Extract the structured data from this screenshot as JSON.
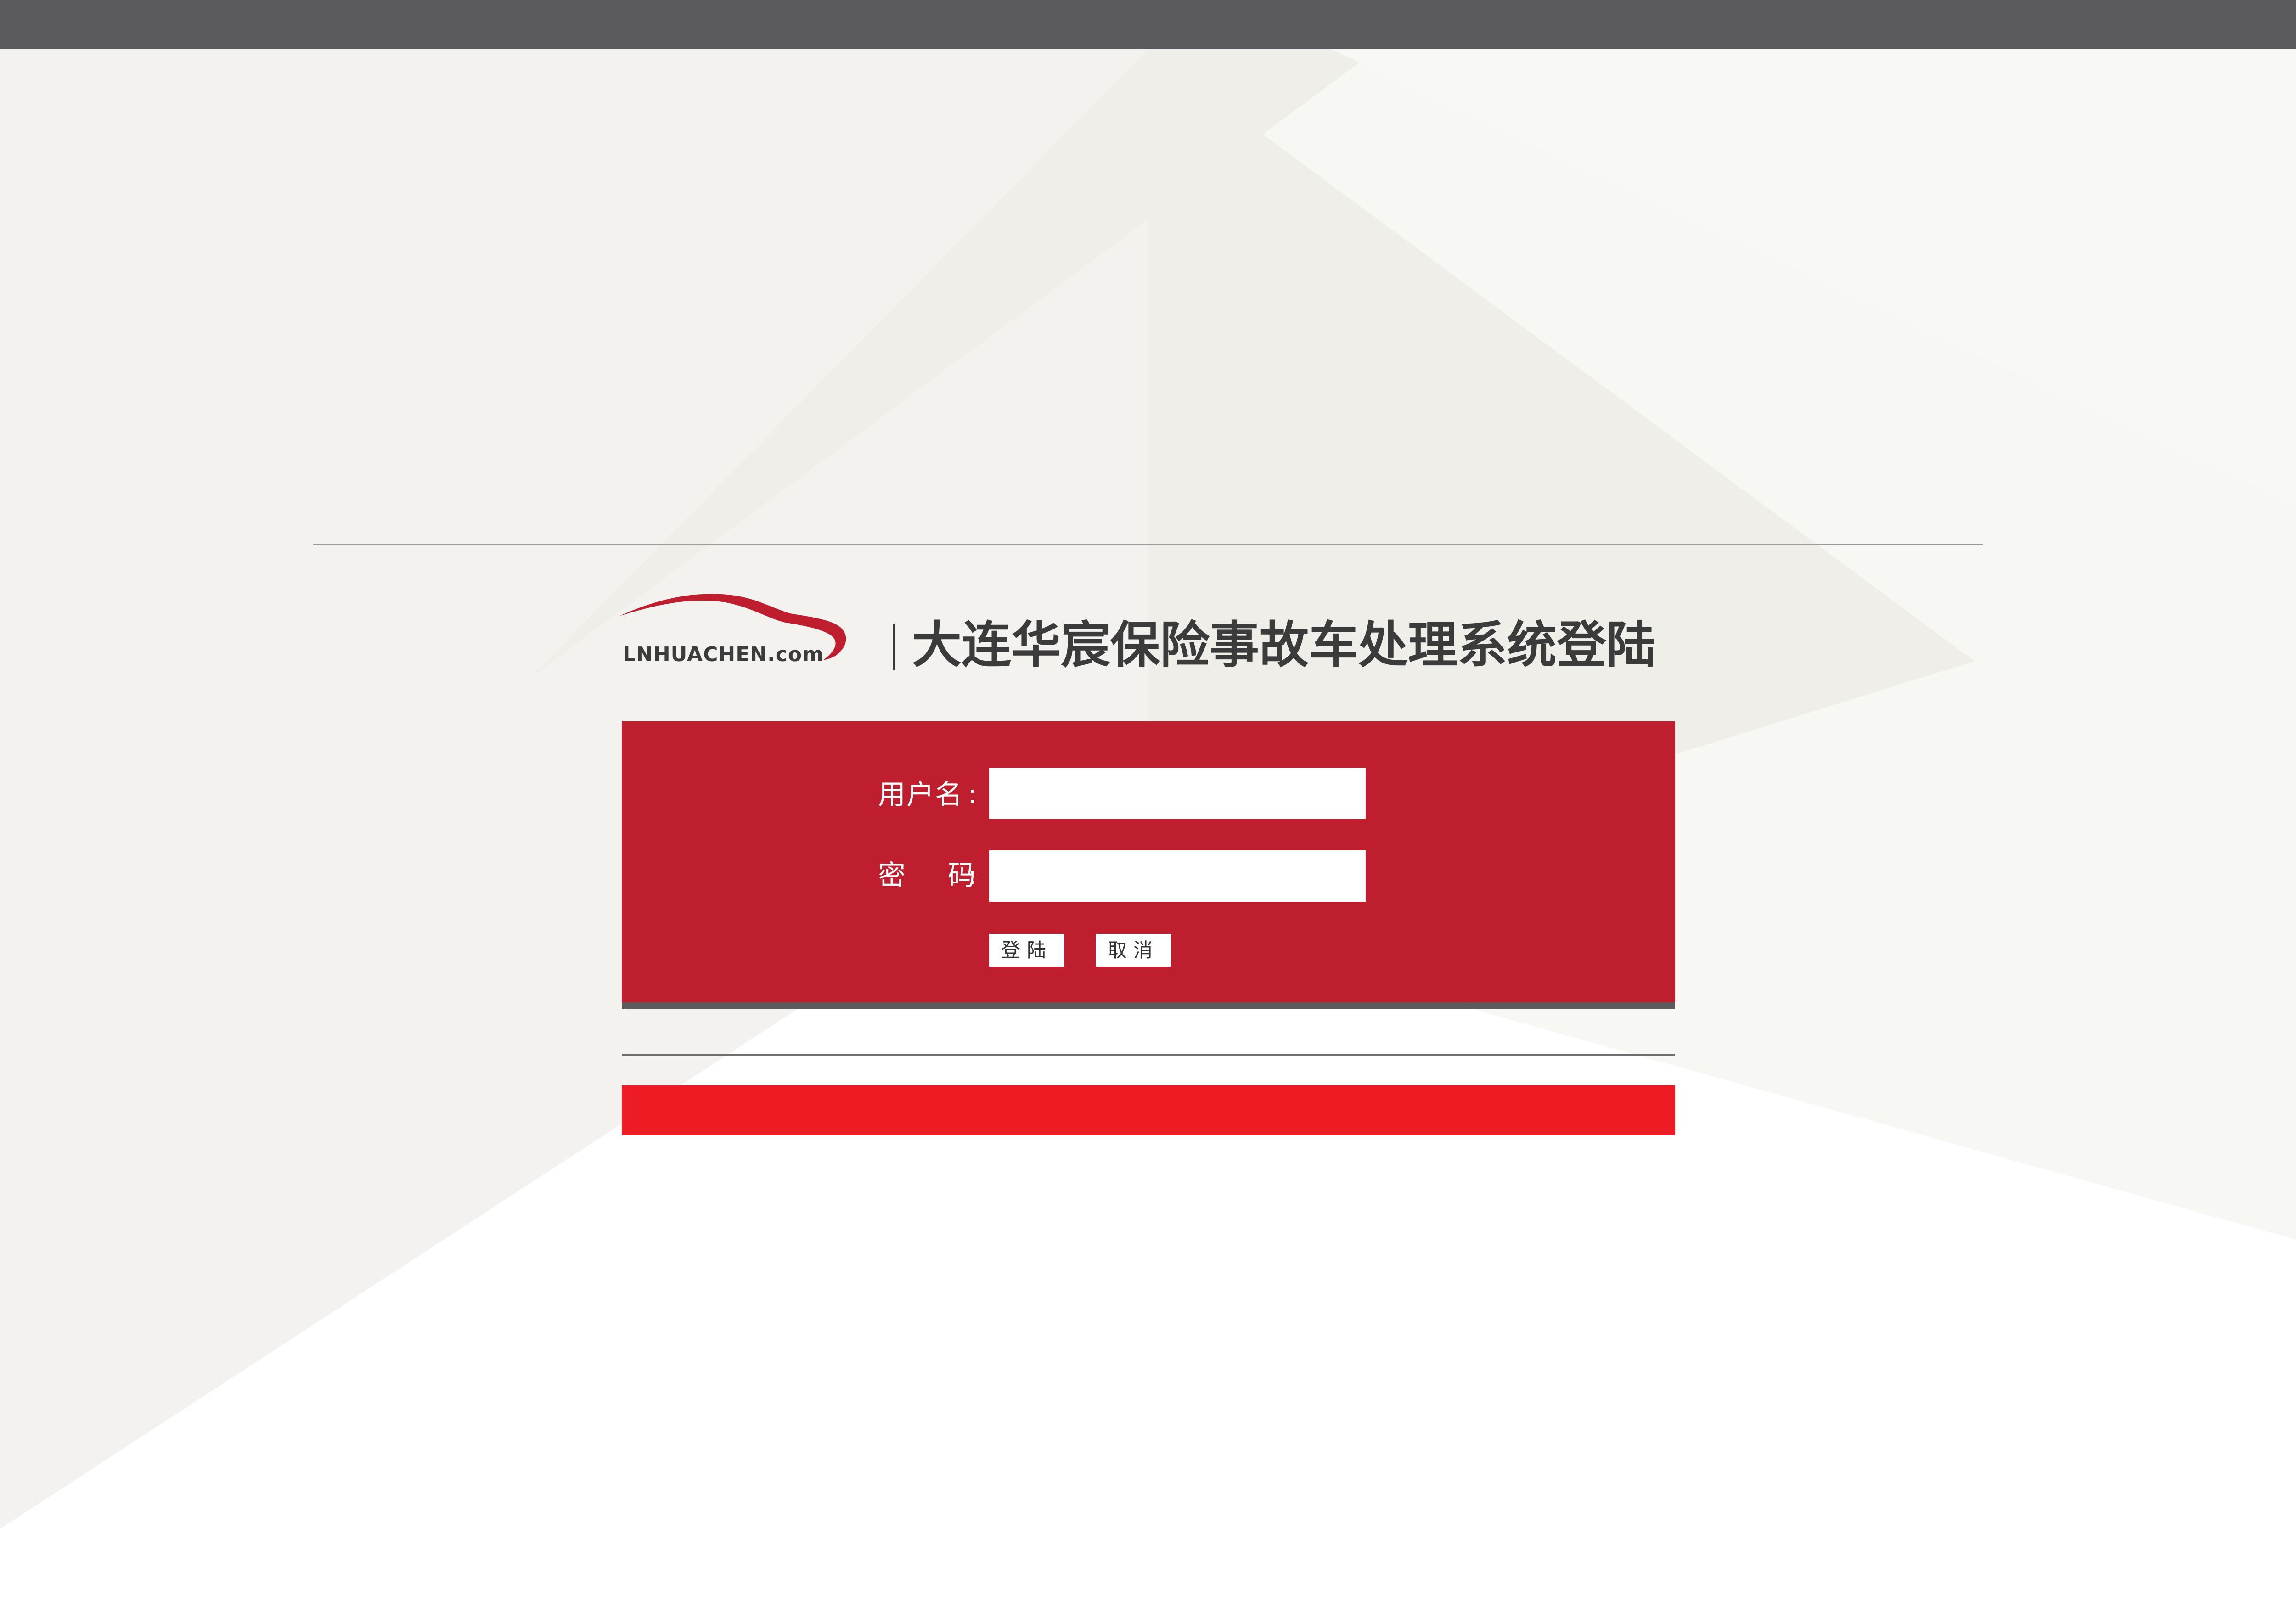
{
  "header": {
    "logo_text": "LNHUACHEN.com",
    "title": "大连华宸保险事故车处理系统登陆"
  },
  "login_form": {
    "username_label": "用户名",
    "password_label": "密码",
    "colon": ":",
    "username_value": "",
    "password_value": "",
    "login_button": "登陆",
    "cancel_button": "取消"
  },
  "colors": {
    "top_bar": "#5a5a5c",
    "panel": "#be1e2d",
    "footer_bar": "#ed1c24",
    "logo_swoosh": "#be1e2d"
  },
  "icons": {
    "logo": "car-swoosh-logo"
  }
}
